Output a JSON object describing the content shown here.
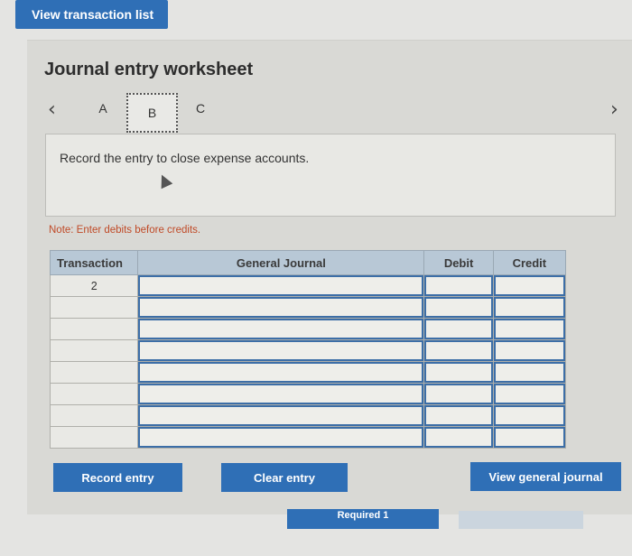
{
  "header": {
    "view_transactions_label": "View transaction list"
  },
  "worksheet": {
    "title": "Journal entry worksheet",
    "tabs": [
      "A",
      "B",
      "C"
    ],
    "active_tab": "B",
    "instruction": "Record the entry to close expense accounts.",
    "note": "Note: Enter debits before credits."
  },
  "table": {
    "columns": [
      "Transaction",
      "General Journal",
      "Debit",
      "Credit"
    ],
    "rows": [
      {
        "transaction": "2",
        "general_journal": "",
        "debit": "",
        "credit": ""
      },
      {
        "transaction": "",
        "general_journal": "",
        "debit": "",
        "credit": ""
      },
      {
        "transaction": "",
        "general_journal": "",
        "debit": "",
        "credit": ""
      },
      {
        "transaction": "",
        "general_journal": "",
        "debit": "",
        "credit": ""
      },
      {
        "transaction": "",
        "general_journal": "",
        "debit": "",
        "credit": ""
      },
      {
        "transaction": "",
        "general_journal": "",
        "debit": "",
        "credit": ""
      },
      {
        "transaction": "",
        "general_journal": "",
        "debit": "",
        "credit": ""
      },
      {
        "transaction": "",
        "general_journal": "",
        "debit": "",
        "credit": ""
      }
    ]
  },
  "buttons": {
    "record_entry": "Record entry",
    "clear_entry": "Clear entry",
    "view_general_journal": "View general journal",
    "required": "Required 1"
  },
  "icons": {
    "prev": "chevron-left-icon",
    "next": "chevron-right-icon",
    "cursor": "mouse-pointer-icon"
  },
  "colors": {
    "accent": "#2f6fb6",
    "note": "#c04a27",
    "header_bg": "#b8c8d6"
  }
}
